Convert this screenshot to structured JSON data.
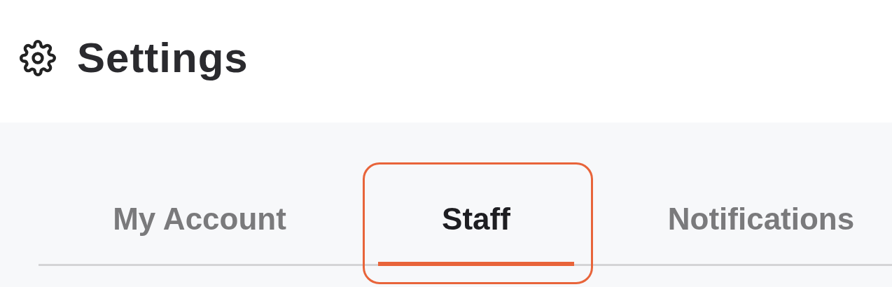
{
  "header": {
    "title": "Settings"
  },
  "tabs": [
    {
      "label": "My Account",
      "selected": false,
      "annotated": false
    },
    {
      "label": "Staff",
      "selected": true,
      "annotated": true
    },
    {
      "label": "Notifications",
      "selected": false,
      "annotated": false
    }
  ]
}
